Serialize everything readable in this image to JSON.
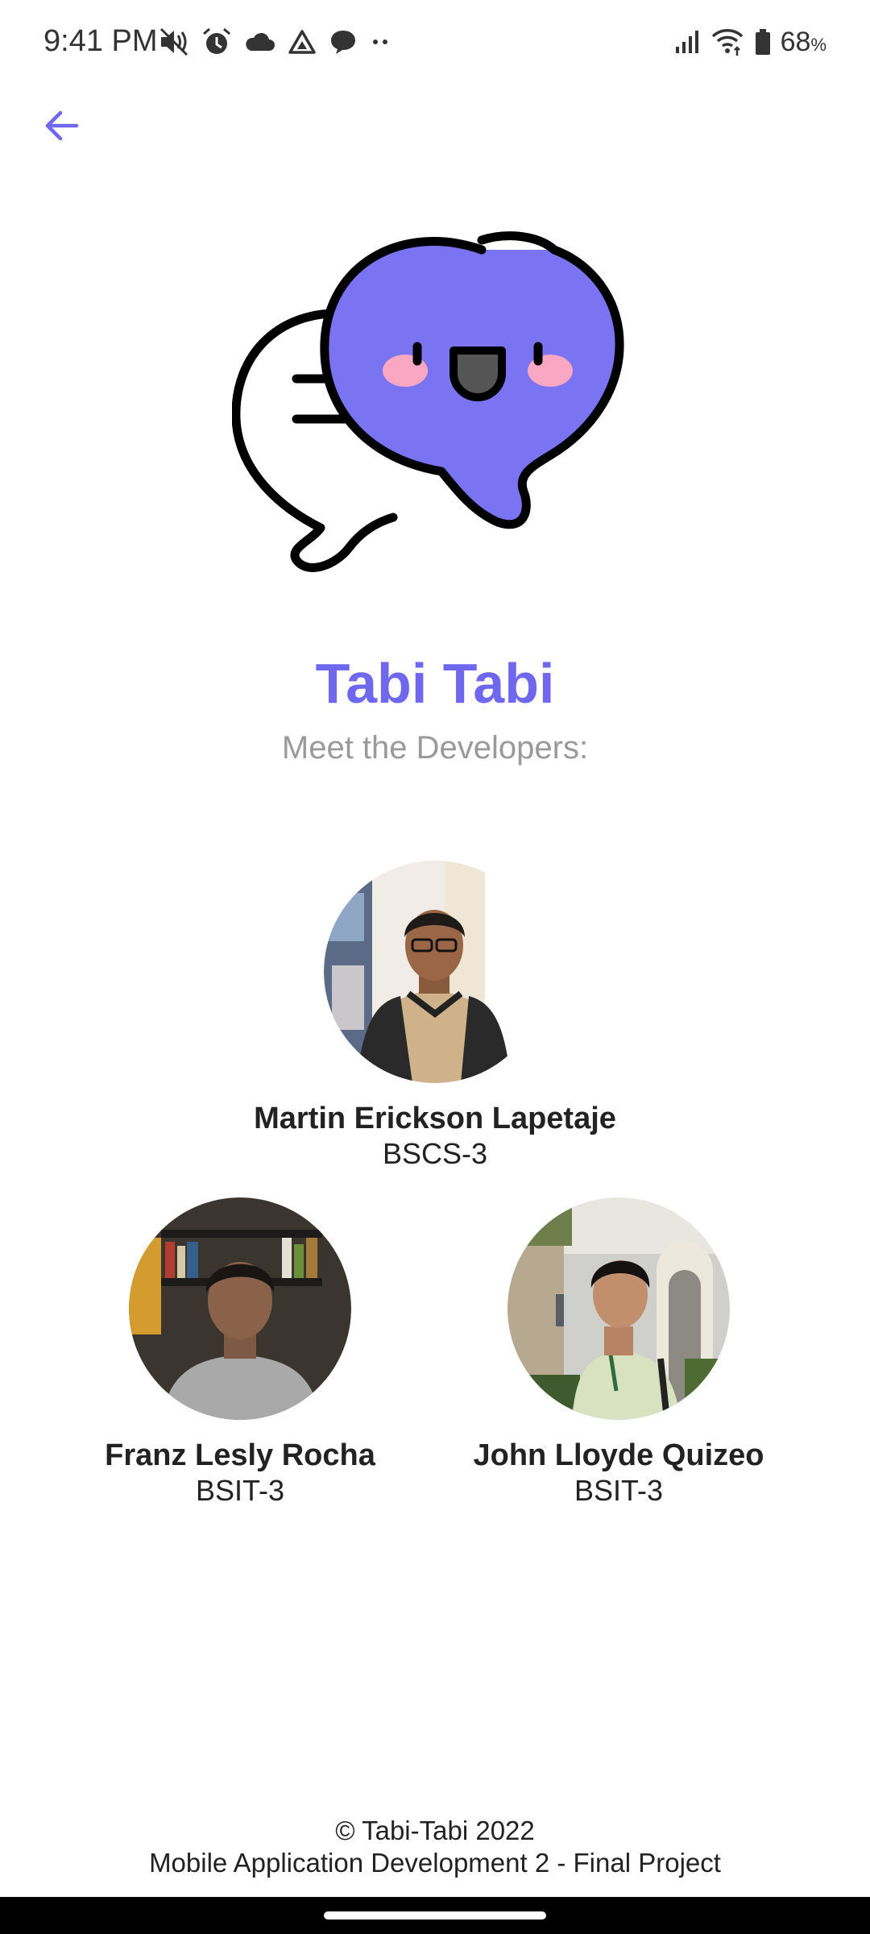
{
  "status_bar": {
    "time": "9:41 PM",
    "battery_percent": "68",
    "battery_unit": "%",
    "icons": [
      "mute-icon",
      "alarm-icon",
      "cloud-icon",
      "drive-icon",
      "chat-icon",
      "more-dots-icon",
      "signal-icon",
      "wifi-icon",
      "battery-icon"
    ]
  },
  "header": {
    "back_icon": "arrow-left-icon"
  },
  "app": {
    "title": "Tabi Tabi",
    "subtitle": "Meet the Developers:",
    "accent_color": "#6f68ef",
    "logo_color": "#7b74f2"
  },
  "developers": [
    {
      "name": "Martin Erickson Lapetaje",
      "course": "BSCS-3"
    },
    {
      "name": "Franz Lesly Rocha",
      "course": "BSIT-3"
    },
    {
      "name": "John Lloyde Quizeo",
      "course": "BSIT-3"
    }
  ],
  "footer": {
    "copyright": "© Tabi-Tabi 2022",
    "project": "Mobile Application Development 2 - Final Project"
  }
}
